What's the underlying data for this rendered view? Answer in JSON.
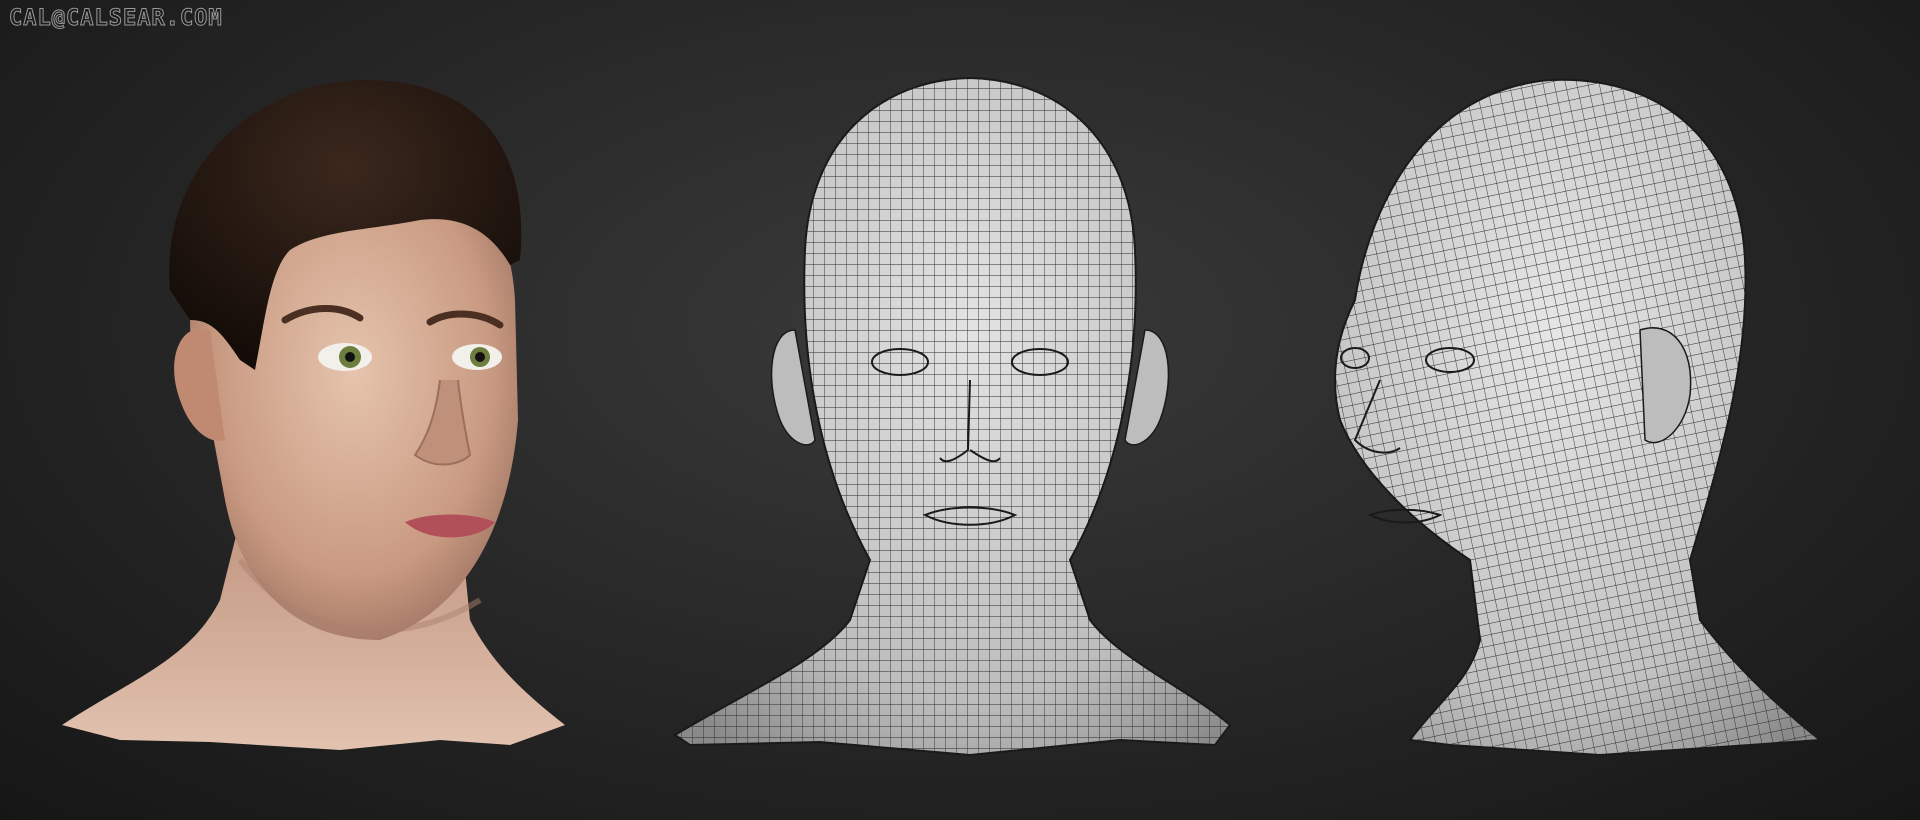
{
  "watermark": "CAL@CALSEAR.COM",
  "colors": {
    "background": "#262626",
    "skin": "#d8b29a",
    "hair": "#2a1a12",
    "wireframe_fill": "#cfcfcf",
    "wireframe_line": "#2a2a2a"
  },
  "renders": [
    {
      "name": "textured-head",
      "style": "textured"
    },
    {
      "name": "wireframe-front",
      "style": "wireframe"
    },
    {
      "name": "wireframe-three-quarter",
      "style": "wireframe"
    }
  ]
}
